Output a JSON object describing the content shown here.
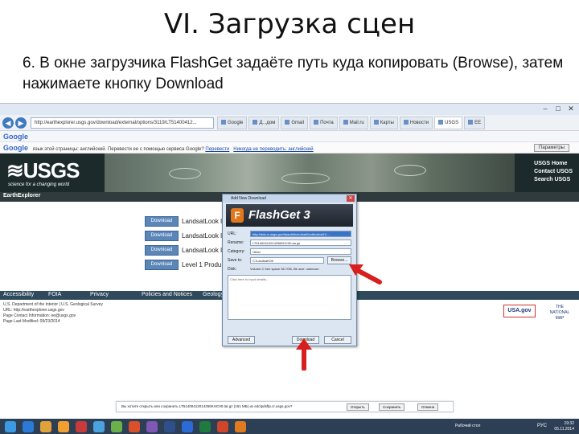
{
  "slide": {
    "title": "VI. Загрузка сцен",
    "text": "6. В окне загрузчика FlashGet задаёте путь куда копировать (Browse), затем нажимаете кнопку Download"
  },
  "browser": {
    "url": "http://earthexplorer.usgs.gov/download/external/options/3119/LT51400412...",
    "tabs": [
      {
        "label": "Google",
        "active": false
      },
      {
        "label": "Д...дом",
        "active": false
      },
      {
        "label": "Gmail",
        "active": false
      },
      {
        "label": "Почта",
        "active": false
      },
      {
        "label": "Mail.ru",
        "active": false
      },
      {
        "label": "Карты",
        "active": false
      },
      {
        "label": "Новости",
        "active": false
      },
      {
        "label": "USGS",
        "active": true
      },
      {
        "label": "EE",
        "active": false
      }
    ],
    "fav_search": "Google",
    "translate_text": "язык этой страницы: английский. Перевести ее с помощью сервиса Google?",
    "translate_link": "Перевести",
    "translate_never": "Никогда не переводить: английский",
    "translate_button": "Параметры"
  },
  "usgs": {
    "logo": "≋USGS",
    "tagline": "science for a changing world",
    "nav": [
      "USGS Home",
      "Contact USGS",
      "Search USGS"
    ],
    "section": "EarthExplorer",
    "download_label": "Download",
    "rows": [
      "LandsatLook I",
      "LandsatLook I",
      "LandsatLook I",
      "Level 1 Produ"
    ],
    "footer_nav": [
      "Accessibility",
      "FOIA",
      "Privacy",
      "Policies and Notices",
      "Geology"
    ],
    "footer_info": [
      "U.S. Department of the Interior | U.S. Geological Survey",
      "URL: http://earthexplorer.usgs.gov",
      "Page Contact Information: ee@usgs.gov",
      "Page Last Modified: 09/23/2014"
    ],
    "usa_gov": "USA.gov",
    "tnm": "THE NATIONAL MAP"
  },
  "flashget": {
    "title": "Add New Download",
    "product": "FlashGet 3",
    "url_label": "URL:",
    "url_value": "http://dds.cr.usgs.gov/ltaauth/hsm/lsat1/collection01/...",
    "rename_label": "Rename:",
    "rename_value": "LT51400412014256KHC00.tar.gz",
    "category_label": "Category:",
    "category_value": "Other",
    "save_label": "Save to:",
    "save_value": "C:\\Landsat\\Olt",
    "browse": "Browse...",
    "disk_label": "Disk:",
    "disk_value": "Volume C free space 36.7GB, file size: unknown",
    "desc_placeholder": "Click here to input details...",
    "advanced": "Advanced",
    "download": "Download",
    "cancel": "Cancel"
  },
  "download_bar": {
    "text": "Вы хотите открыть или сохранить LT51400412014256KHC00.tar.gz (151 МБ) из edclpdsftp.cr.usgs.gov?",
    "open": "Открыть",
    "save": "Сохранить",
    "cancel": "Отмена"
  },
  "taskbar": {
    "label": "Рабочий стол",
    "lang": "РУС",
    "time": "19:32",
    "date": "05.11.2014"
  },
  "colors": {
    "usgs_dark": "#1c2a2c",
    "download_btn": "#5b86b8",
    "arrow": "#d81e1e",
    "taskbar": "#2c3f55"
  }
}
